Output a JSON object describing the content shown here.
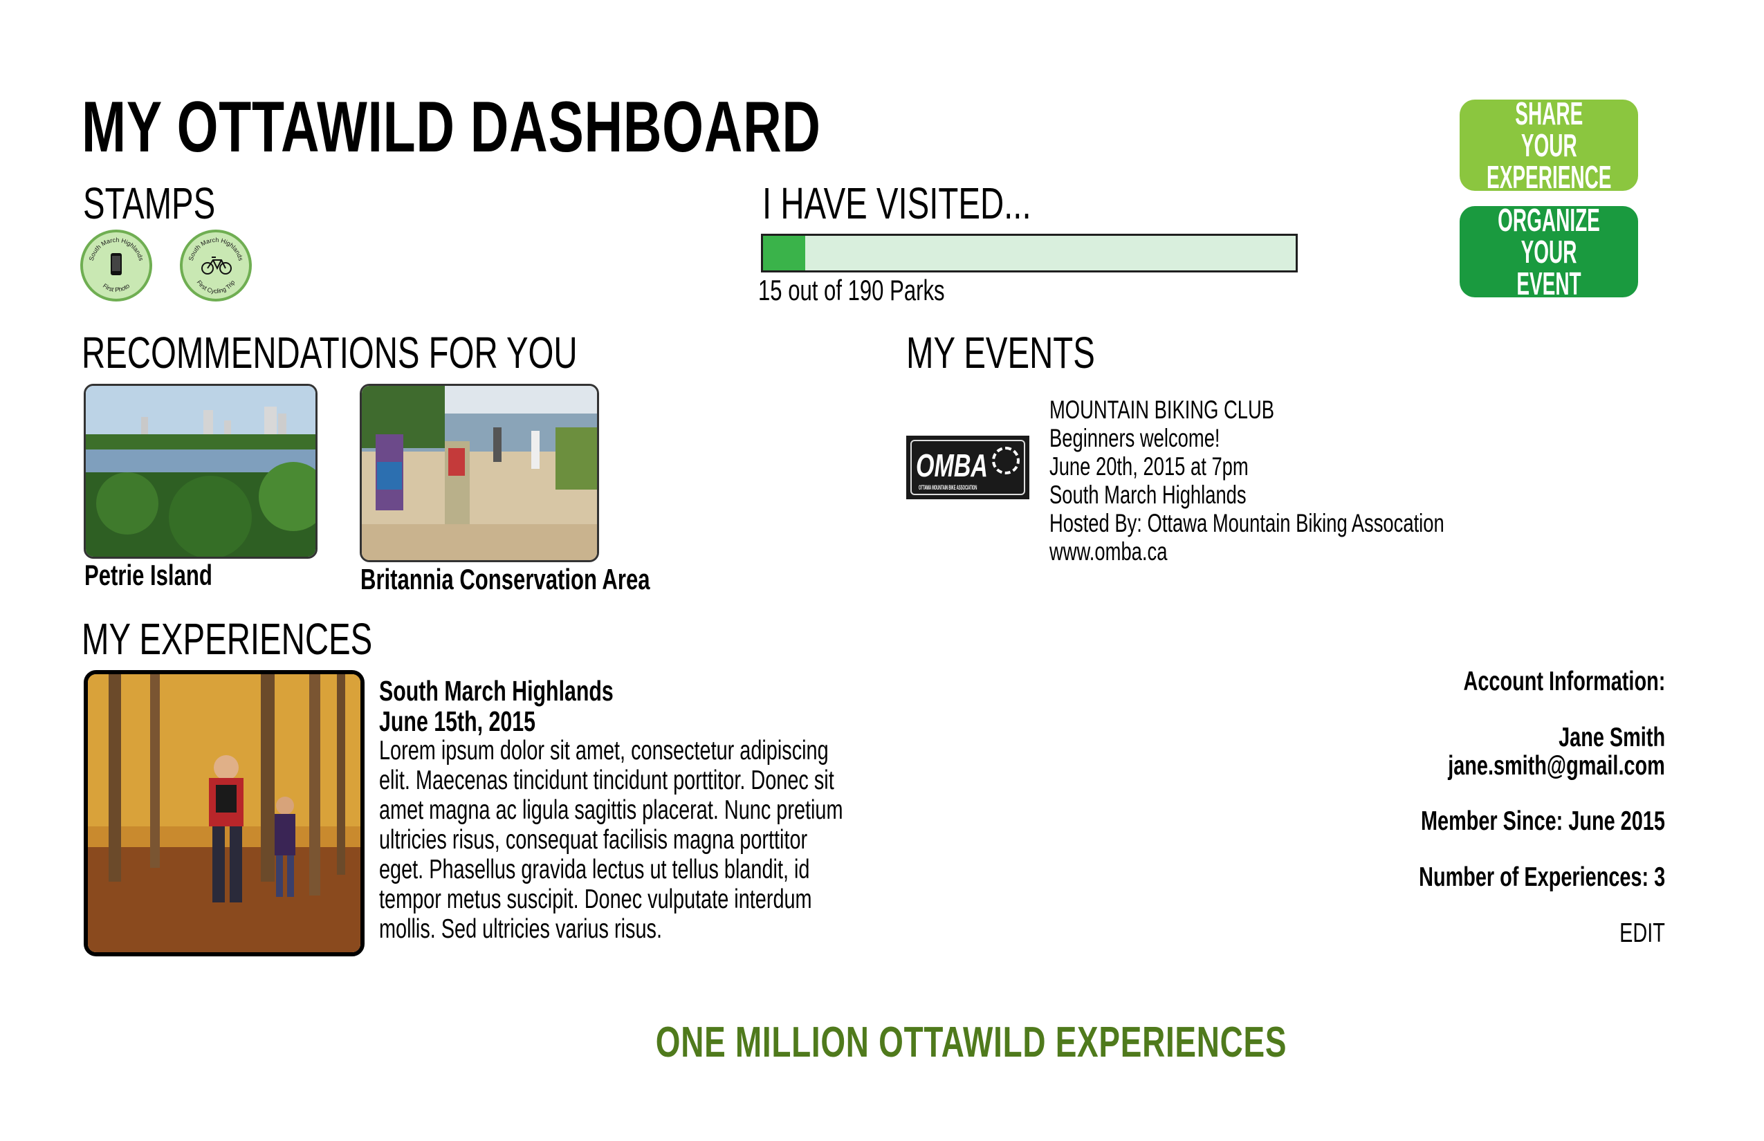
{
  "page": {
    "title": "MY OTTAWILD DASHBOARD"
  },
  "stamps": {
    "heading": "STAMPS",
    "items": [
      {
        "arc_top": "South March Highlands",
        "arc_bottom": "First Photo",
        "icon": "phone-icon"
      },
      {
        "arc_top": "South March Highlands",
        "arc_bottom": "First Cycling Trip",
        "icon": "bicycle-icon"
      }
    ]
  },
  "visited": {
    "heading": "I HAVE VISITED...",
    "count": 15,
    "total": 190,
    "label": "15 out of 190 Parks"
  },
  "actions": {
    "share_line1": "SHARE YOUR",
    "share_line2": "EXPERIENCE",
    "organize_line1": "ORGANIZE YOUR",
    "organize_line2": "EVENT"
  },
  "recommendations": {
    "heading": "RECOMMENDATIONS  FOR YOU",
    "items": [
      {
        "label": "Petrie Island"
      },
      {
        "label": "Britannia Conservation Area"
      }
    ]
  },
  "events": {
    "heading": "MY EVENTS",
    "items": [
      {
        "logo_text": "OMBA",
        "logo_subtext": "OTTAWA MOUNTAIN BIKE ASSOCIATION",
        "name": "MOUNTAIN BIKING CLUB",
        "note": "Beginners welcome!",
        "datetime": "June 20th, 2015 at 7pm",
        "location": "South March Highlands",
        "host": "Hosted By: Ottawa Mountain Biking Assocation",
        "url": "www.omba.ca"
      }
    ]
  },
  "experiences": {
    "heading": "MY EXPERIENCES",
    "items": [
      {
        "place": "South March Highlands",
        "date": "June 15th, 2015",
        "lines": [
          "Lorem ipsum dolor sit amet, consectetur adipiscing",
          "elit. Maecenas tincidunt tincidunt porttitor. Donec sit",
          "amet magna ac ligula sagittis placerat. Nunc pretium",
          "ultricies risus, consequat facilisis magna porttitor",
          "eget. Phasellus gravida lectus ut tellus blandit, id",
          "tempor metus suscipit. Donec vulputate interdum",
          "mollis. Sed ultricies varius risus."
        ]
      }
    ]
  },
  "account": {
    "heading": "Account Information:",
    "name": "Jane Smith",
    "email": "jane.smith@gmail.com",
    "member_since": "Member Since: June 2015",
    "experience_count": "Number of Experiences: 3",
    "edit_label": "EDIT"
  },
  "footer": {
    "slogan": "ONE MILLION OTTAWILD EXPERIENCES"
  },
  "colors": {
    "share_button": "#8bc63f",
    "organize_button": "#1a9a3f",
    "progress_fill": "#3ab34a",
    "progress_track": "#d9efdd",
    "stamp_fill": "#c9e8b3",
    "stamp_border": "#6fae52",
    "slogan": "#4f7a1c"
  }
}
